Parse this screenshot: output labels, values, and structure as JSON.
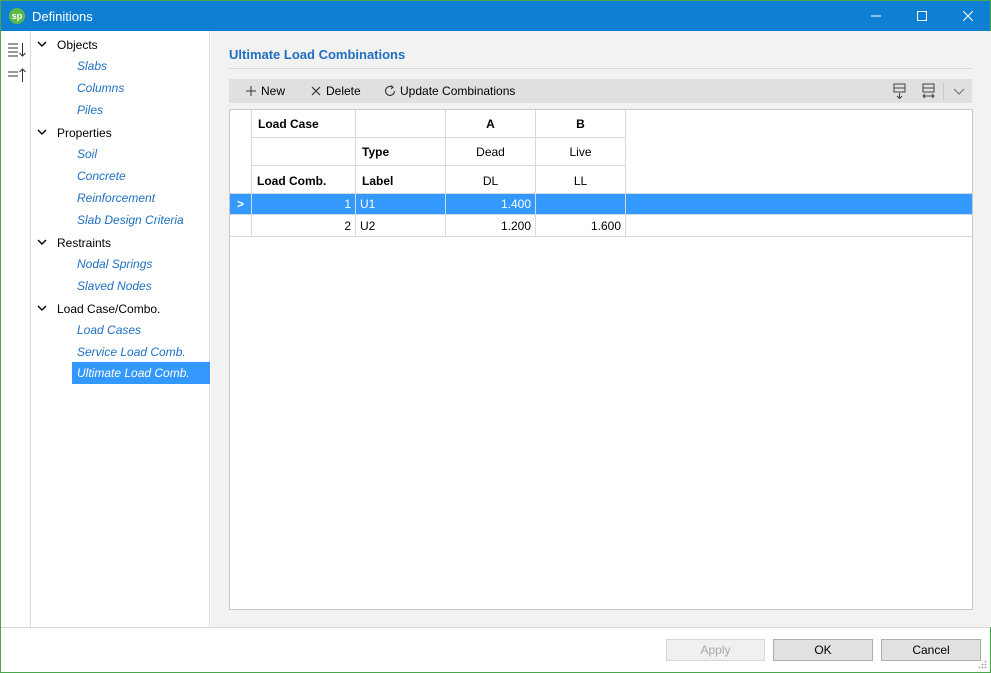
{
  "window": {
    "title": "Definitions",
    "logo_text": "sp",
    "controls": {
      "minimize": "minimize-icon",
      "maximize": "maximize-icon",
      "close": "close-icon"
    }
  },
  "left_strip": {
    "icons": [
      "sort-descending-icon",
      "sort-ascending-icon"
    ]
  },
  "tree": {
    "categories": [
      {
        "label": "Objects",
        "items": [
          "Slabs",
          "Columns",
          "Piles"
        ]
      },
      {
        "label": "Properties",
        "items": [
          "Soil",
          "Concrete",
          "Reinforcement",
          "Slab Design Criteria"
        ]
      },
      {
        "label": "Restraints",
        "items": [
          "Nodal Springs",
          "Slaved Nodes"
        ]
      },
      {
        "label": "Load Case/Combo.",
        "items": [
          "Load Cases",
          "Service Load Comb.",
          "Ultimate Load Comb."
        ]
      }
    ],
    "selected": "Ultimate Load Comb."
  },
  "content": {
    "title": "Ultimate Load Combinations",
    "toolbar": {
      "new_label": "New",
      "delete_label": "Delete",
      "update_label": "Update Combinations",
      "icons": [
        "add-icon",
        "delete-icon",
        "refresh-icon",
        "insert-row-icon",
        "expand-columns-icon",
        "chevron-down-icon"
      ]
    },
    "grid": {
      "header_row1": {
        "load_case": "Load Case",
        "col_a": "A",
        "col_b": "B"
      },
      "header_row2": {
        "type": "Type",
        "col_a": "Dead",
        "col_b": "Live"
      },
      "header_row3": {
        "load_comb": "Load Comb.",
        "label": "Label",
        "col_a": "DL",
        "col_b": "LL"
      },
      "rows": [
        {
          "num": "1",
          "label": "U1",
          "a": "1.400",
          "b": "",
          "selected": true
        },
        {
          "num": "2",
          "label": "U2",
          "a": "1.200",
          "b": "1.600",
          "selected": false
        }
      ],
      "current_row_indicator": ">"
    }
  },
  "footer": {
    "apply_label": "Apply",
    "ok_label": "OK",
    "cancel_label": "Cancel"
  },
  "colors": {
    "titlebar": "#0f7fd4",
    "accent": "#1f6fc0",
    "selection": "#3399ff",
    "window_border": "#4aa64a"
  }
}
